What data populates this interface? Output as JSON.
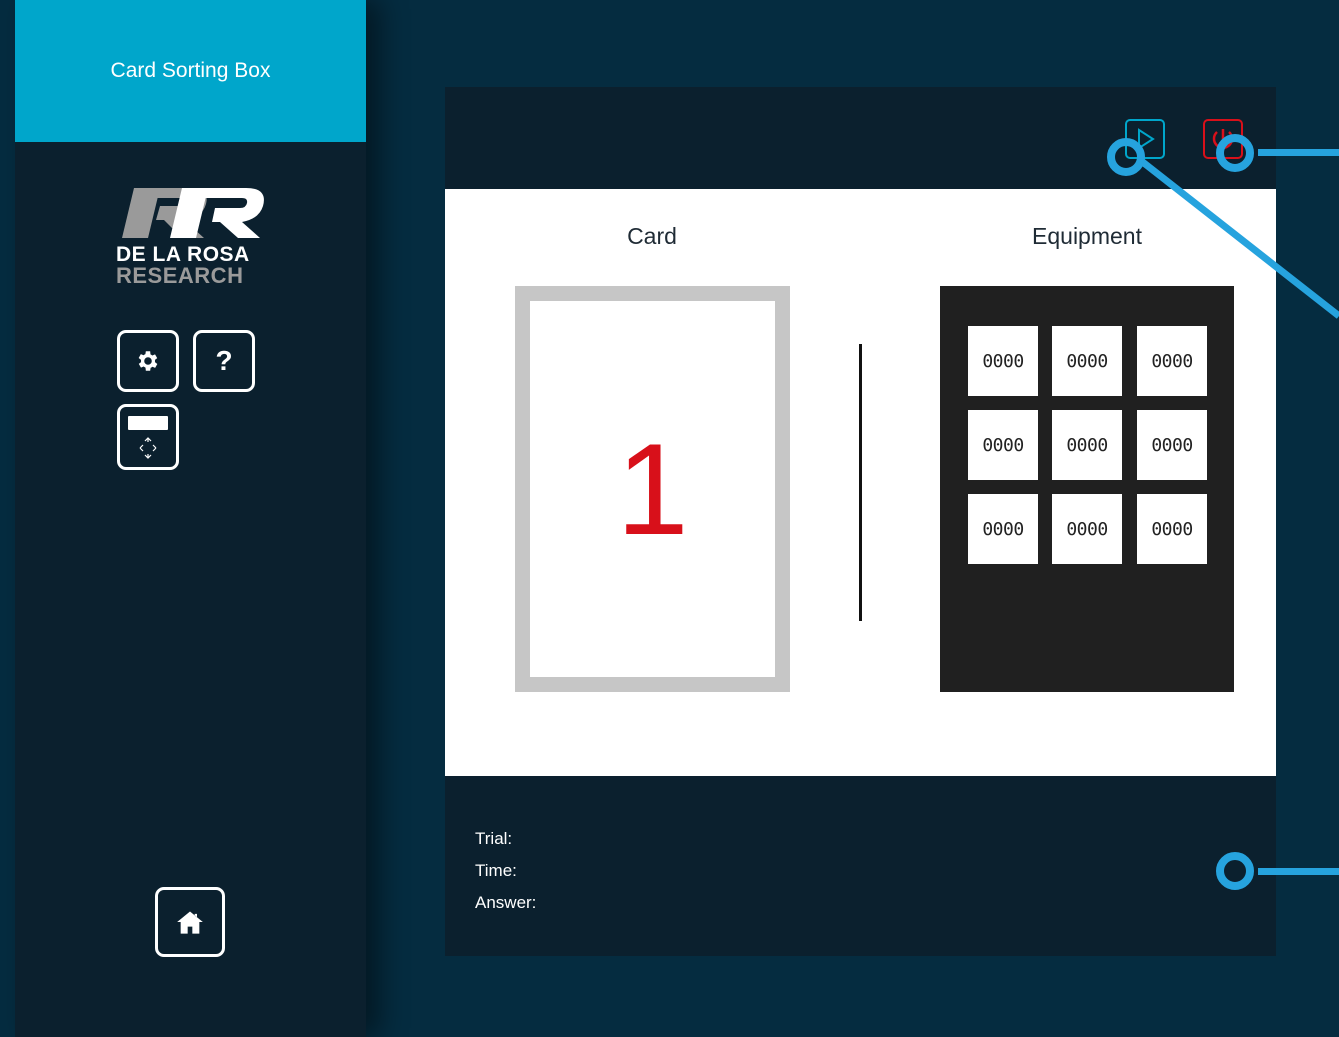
{
  "app": {
    "title": "Card Sorting Box"
  },
  "logo": {
    "line1": "DE LA ROSA",
    "line2": "RESEARCH"
  },
  "sidebar": {
    "buttons": [
      {
        "name": "settings",
        "icon": "gear-icon"
      },
      {
        "name": "help",
        "icon": "question-icon",
        "label": "?"
      },
      {
        "name": "display",
        "icon": "display-icon"
      },
      {
        "name": "home",
        "icon": "home-icon"
      }
    ]
  },
  "toolbar": {
    "play": {
      "icon": "play-icon",
      "color": "#00a6cb"
    },
    "power": {
      "icon": "power-icon",
      "color": "#d8101a"
    }
  },
  "card_section": {
    "title": "Card",
    "number": "1"
  },
  "equipment_section": {
    "title": "Equipment",
    "cells": [
      "0000",
      "0000",
      "0000",
      "0000",
      "0000",
      "0000",
      "0000",
      "0000",
      "0000"
    ]
  },
  "status": {
    "trial_label": "Trial:",
    "time_label": "Time:",
    "answer_label": "Answer:"
  },
  "colors": {
    "accent": "#00a6cb",
    "callout": "#26a3de",
    "danger": "#d8101a",
    "panel": "#0b202e",
    "background": "#052c40"
  }
}
